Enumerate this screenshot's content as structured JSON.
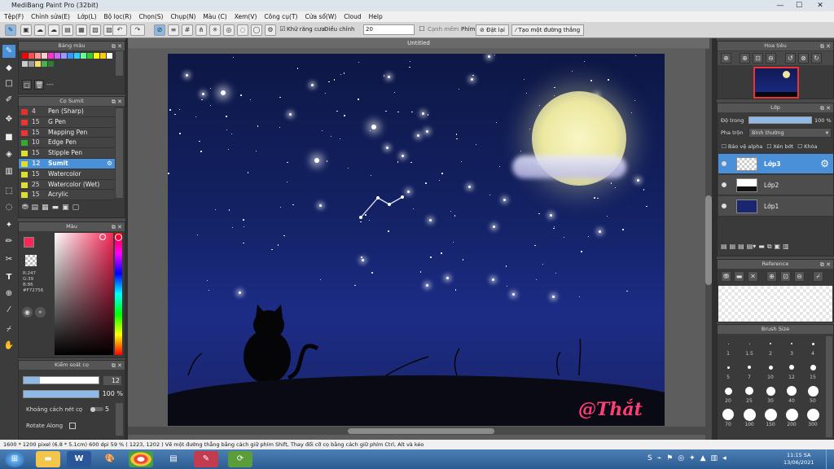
{
  "window": {
    "title": "MediBang Paint Pro (32bit)",
    "minimize": "—",
    "maximize": "☐",
    "close": "✕"
  },
  "menu": [
    "Tệp(F)",
    "Chỉnh sửa(E)",
    "Lớp(L)",
    "Bộ lọc(R)",
    "Chọn(S)",
    "Chụp(N)",
    "Màu (C)",
    "Xem(V)",
    "Công cụ(T)",
    "Cửa sổ(W)",
    "Cloud",
    "Help"
  ],
  "toolbar": {
    "antialias_label": "Khử răng cưa",
    "correction_label": "Điều chỉnh",
    "correction_value": "20",
    "smooth_label": "Cạnh mềm",
    "key_label": "Phím",
    "reset_label": "Đặt lại",
    "straight_line_label": "Tạo một đường thẳng"
  },
  "palette_panel": {
    "title": "Bảng màu",
    "dash": "---",
    "colors": [
      "#ff0000",
      "#ff4d4d",
      "#ff9999",
      "#ffcccc",
      "#ff33cc",
      "#cc66ff",
      "#9999ff",
      "#3399ff",
      "#33ccff",
      "#66ff99",
      "#33cc33",
      "#ffff00",
      "#ffcc00",
      "#ffffff",
      "#cccccc",
      "#999999",
      "#ffd966",
      "#4caf50",
      "#2e7d32"
    ]
  },
  "brush_panel": {
    "title": "Cọ Sumit",
    "brushes": [
      {
        "size": "4",
        "name": "Pen (Sharp)",
        "color": "#d33"
      },
      {
        "size": "15",
        "name": "G Pen",
        "color": "#e33"
      },
      {
        "size": "15",
        "name": "Mapping Pen",
        "color": "#e33"
      },
      {
        "size": "10",
        "name": "Edge Pen",
        "color": "#3a3"
      },
      {
        "size": "15",
        "name": "Stipple Pen",
        "color": "#dd3"
      },
      {
        "size": "12",
        "name": "Sumit",
        "color": "#dd3"
      },
      {
        "size": "15",
        "name": "Watercolor",
        "color": "#dd3"
      },
      {
        "size": "25",
        "name": "Watercolor (Wet)",
        "color": "#dd3"
      },
      {
        "size": "15",
        "name": "Acrylic",
        "color": "#dd3"
      }
    ]
  },
  "color_panel": {
    "title": "Màu",
    "r": "R:247",
    "g": "G:39",
    "b": "B:86",
    "hex": "#F72756",
    "current": "#f72756"
  },
  "control_panel": {
    "title": "Kiểm soát cọ",
    "size_value": "12",
    "opacity_value": "100 %",
    "spacing_label": "Khoảng cách nét cọ",
    "spacing_value": "5",
    "rotate_label": "Rotate Along"
  },
  "document": {
    "tab": "Untitled",
    "signature": "@Thắt"
  },
  "statusbar": {
    "text": "1600 * 1200 pixel  (6.8 * 5.1cm)  600 dpi  59 %  ( 1223, 1202 )  Vẽ một đường thẳng bằng cách giữ phím Shift, Thay đổi cỡ cọ bằng cách giữ phím Ctrl, Alt và kéo"
  },
  "navigator": {
    "title": "Hoa tiêu"
  },
  "layer_panel": {
    "title": "Lớp",
    "opacity_label": "Độ trong",
    "opacity_value": "100 %",
    "blend_label": "Pha trộn",
    "blend_value": "Bình thường",
    "protect_alpha": "Bảo vệ alpha",
    "clip": "Xén bớt",
    "lock": "Khóa",
    "layers": [
      {
        "name": "Lớp3"
      },
      {
        "name": "Lớp2"
      },
      {
        "name": "Lớp1"
      }
    ]
  },
  "reference_panel": {
    "title": "Reference"
  },
  "brush_size_panel": {
    "title": "Brush Size",
    "sizes": [
      "1",
      "1.5",
      "2",
      "3",
      "4",
      "5",
      "7",
      "10",
      "12",
      "15",
      "20",
      "25",
      "30",
      "40",
      "50",
      "70",
      "100",
      "150",
      "200",
      "300"
    ]
  },
  "taskbar": {
    "time": "11:15 SA",
    "date": "13/06/2021"
  }
}
